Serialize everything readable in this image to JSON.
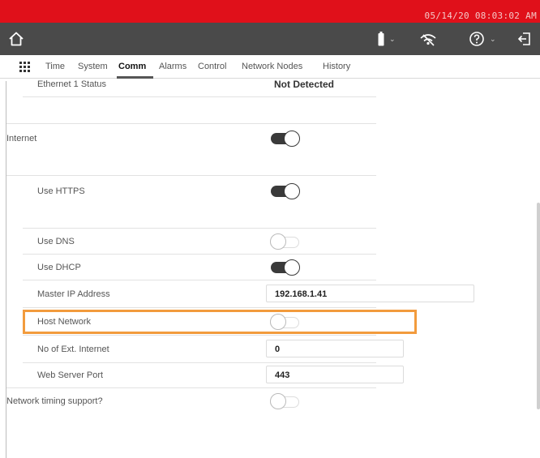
{
  "status_bar": {
    "datetime": "05/14/20 08:03:02 AM",
    "color": "#e0101a"
  },
  "toolbar": {
    "color": "#4a4a4a",
    "icons": [
      "home-icon",
      "battery-icon",
      "wifi-off-icon",
      "help-icon",
      "logout-icon"
    ]
  },
  "tabs": [
    "Time",
    "System",
    "Comm",
    "Alarms",
    "Control",
    "Network Nodes",
    "History"
  ],
  "active_tab": "Comm",
  "settings": {
    "ethernet_status": {
      "label": "Ethernet 1 Status",
      "value": "Not Detected"
    },
    "internet": {
      "label": "Internet",
      "state": "on"
    },
    "use_https": {
      "label": "Use HTTPS",
      "state": "on"
    },
    "use_dns": {
      "label": "Use DNS",
      "state": "off"
    },
    "use_dhcp": {
      "label": "Use DHCP",
      "state": "on"
    },
    "master_ip": {
      "label": "Master IP Address",
      "value": "192.168.1.41"
    },
    "host_network": {
      "label": "Host Network",
      "state": "off"
    },
    "ext_internet": {
      "label": "No of Ext. Internet",
      "value": "0"
    },
    "web_port": {
      "label": "Web Server Port",
      "value": "443"
    },
    "timing_support": {
      "label": "Network timing support?",
      "state": "off"
    }
  },
  "highlight_color": "#f29b3d"
}
